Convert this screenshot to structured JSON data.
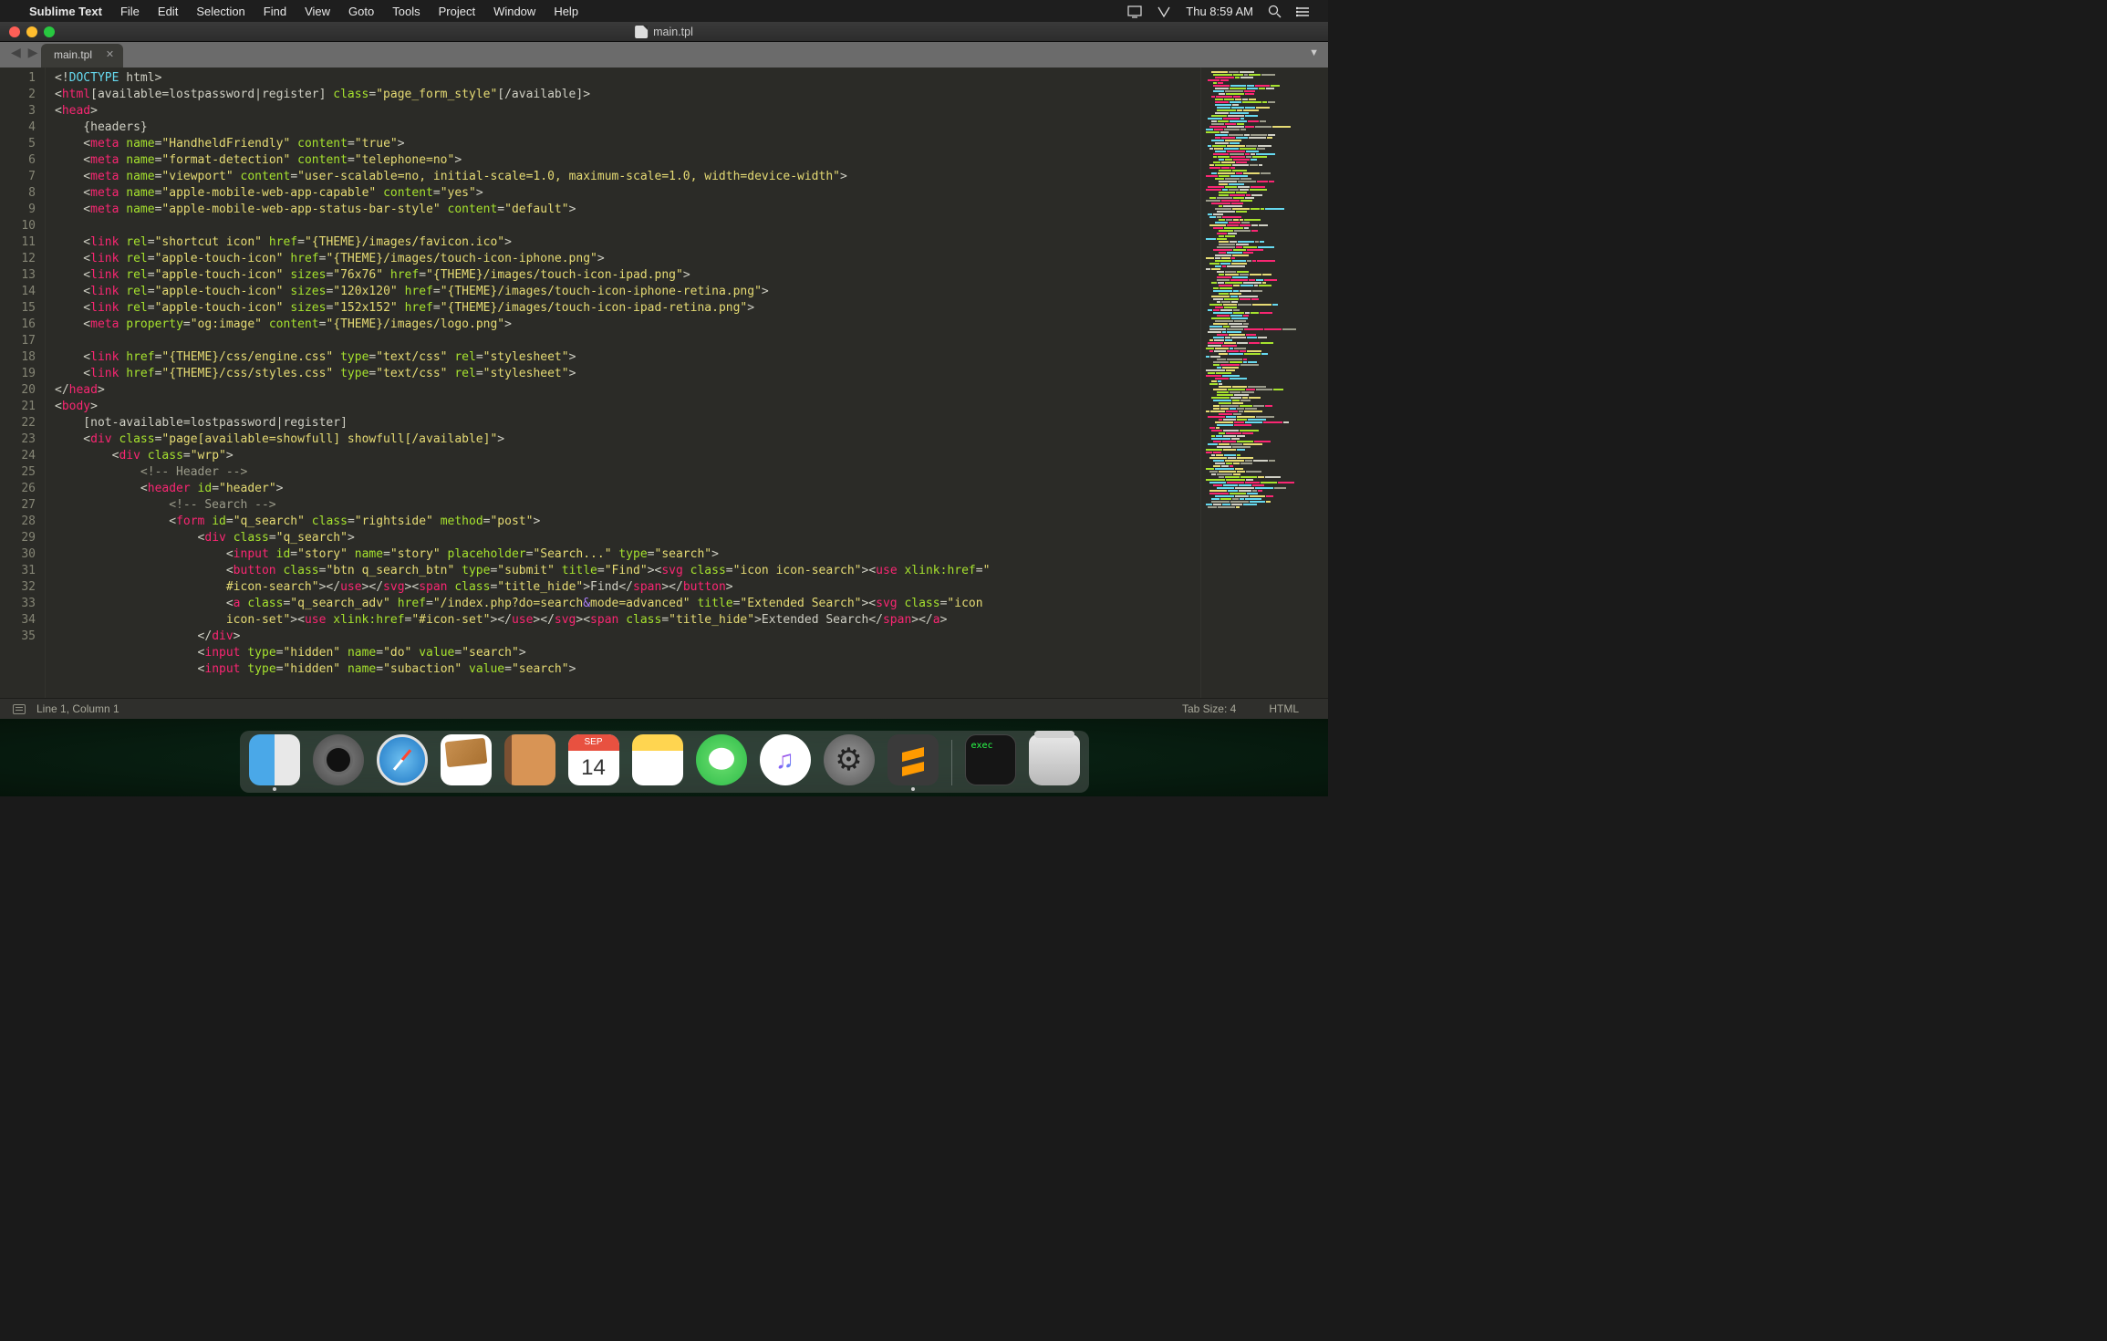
{
  "menubar": {
    "app": "Sublime Text",
    "items": [
      "File",
      "Edit",
      "Selection",
      "Find",
      "View",
      "Goto",
      "Tools",
      "Project",
      "Window",
      "Help"
    ],
    "clock": "Thu 8:59 AM"
  },
  "titlebar": {
    "filename": "main.tpl"
  },
  "tab": {
    "name": "main.tpl"
  },
  "gutter_lines": [
    "1",
    "2",
    "3",
    "4",
    "5",
    "6",
    "7",
    "8",
    "9",
    "10",
    "11",
    "12",
    "13",
    "14",
    "15",
    "16",
    "17",
    "18",
    "19",
    "20",
    "21",
    "22",
    "23",
    "24",
    "25",
    "26",
    "27",
    "28",
    "29",
    "30",
    "31",
    "32",
    "33",
    "34",
    "35"
  ],
  "code": {
    "l1": {
      "a": "<!",
      "b": "DOCTYPE",
      "c": " html",
      "d": ">"
    },
    "l2": {
      "a": "<",
      "b": "html",
      "c": "[available=lostpassword|register] ",
      "d": "class",
      "e": "=",
      "f": "\"page_form_style\"",
      "g": "[/available]",
      "h": ">"
    },
    "l3": {
      "a": "<",
      "b": "head",
      "c": ">"
    },
    "l4": "    {headers}",
    "l5": {
      "a": "    <",
      "b": "meta",
      "sp": " ",
      "c": "name",
      "d": "=",
      "e": "\"HandheldFriendly\"",
      "sp2": " ",
      "f": "content",
      "g": "=",
      "h": "\"true\"",
      "i": ">"
    },
    "l6": {
      "a": "    <",
      "b": "meta",
      "sp": " ",
      "c": "name",
      "d": "=",
      "e": "\"format-detection\"",
      "sp2": " ",
      "f": "content",
      "g": "=",
      "h": "\"telephone=no\"",
      "i": ">"
    },
    "l7": {
      "a": "    <",
      "b": "meta",
      "sp": " ",
      "c": "name",
      "d": "=",
      "e": "\"viewport\"",
      "sp2": " ",
      "f": "content",
      "g": "=",
      "h": "\"user-scalable=no, initial-scale=1.0, maximum-scale=1.0, width=device-width\"",
      "i": ">"
    },
    "l8": {
      "a": "    <",
      "b": "meta",
      "sp": " ",
      "c": "name",
      "d": "=",
      "e": "\"apple-mobile-web-app-capable\"",
      "sp2": " ",
      "f": "content",
      "g": "=",
      "h": "\"yes\"",
      "i": ">"
    },
    "l9": {
      "a": "    <",
      "b": "meta",
      "sp": " ",
      "c": "name",
      "d": "=",
      "e": "\"apple-mobile-web-app-status-bar-style\"",
      "sp2": " ",
      "f": "content",
      "g": "=",
      "h": "\"default\"",
      "i": ">"
    },
    "l11": {
      "a": "    <",
      "b": "link",
      "sp": " ",
      "c": "rel",
      "d": "=",
      "e": "\"shortcut icon\"",
      "sp2": " ",
      "f": "href",
      "g": "=",
      "h": "\"{THEME}/images/favicon.ico\"",
      "i": ">"
    },
    "l12": {
      "a": "    <",
      "b": "link",
      "sp": " ",
      "c": "rel",
      "d": "=",
      "e": "\"apple-touch-icon\"",
      "sp2": " ",
      "f": "href",
      "g": "=",
      "h": "\"{THEME}/images/touch-icon-iphone.png\"",
      "i": ">"
    },
    "l13": {
      "a": "    <",
      "b": "link",
      "sp": " ",
      "c": "rel",
      "d": "=",
      "e": "\"apple-touch-icon\"",
      "sp2": " ",
      "f": "sizes",
      "g": "=",
      "h": "\"76x76\"",
      "sp3": " ",
      "i": "href",
      "j": "=",
      "k": "\"{THEME}/images/touch-icon-ipad.png\"",
      "l": ">"
    },
    "l14": {
      "a": "    <",
      "b": "link",
      "sp": " ",
      "c": "rel",
      "d": "=",
      "e": "\"apple-touch-icon\"",
      "sp2": " ",
      "f": "sizes",
      "g": "=",
      "h": "\"120x120\"",
      "sp3": " ",
      "i": "href",
      "j": "=",
      "k": "\"{THEME}/images/touch-icon-iphone-retina.png\"",
      "l": ">"
    },
    "l15": {
      "a": "    <",
      "b": "link",
      "sp": " ",
      "c": "rel",
      "d": "=",
      "e": "\"apple-touch-icon\"",
      "sp2": " ",
      "f": "sizes",
      "g": "=",
      "h": "\"152x152\"",
      "sp3": " ",
      "i": "href",
      "j": "=",
      "k": "\"{THEME}/images/touch-icon-ipad-retina.png\"",
      "l": ">"
    },
    "l16": {
      "a": "    <",
      "b": "meta",
      "sp": " ",
      "c": "property",
      "d": "=",
      "e": "\"og:image\"",
      "sp2": " ",
      "f": "content",
      "g": "=",
      "h": "\"{THEME}/images/logo.png\"",
      "i": ">"
    },
    "l18": {
      "a": "    <",
      "b": "link",
      "sp": " ",
      "c": "href",
      "d": "=",
      "e": "\"{THEME}/css/engine.css\"",
      "sp2": " ",
      "f": "type",
      "g": "=",
      "h": "\"text/css\"",
      "sp3": " ",
      "i": "rel",
      "j": "=",
      "k": "\"stylesheet\"",
      "l": ">"
    },
    "l19": {
      "a": "    <",
      "b": "link",
      "sp": " ",
      "c": "href",
      "d": "=",
      "e": "\"{THEME}/css/styles.css\"",
      "sp2": " ",
      "f": "type",
      "g": "=",
      "h": "\"text/css\"",
      "sp3": " ",
      "i": "rel",
      "j": "=",
      "k": "\"stylesheet\"",
      "l": ">"
    },
    "l20": {
      "a": "</",
      "b": "head",
      "c": ">"
    },
    "l21": {
      "a": "<",
      "b": "body",
      "c": ">"
    },
    "l22": "    [not-available=lostpassword|register]",
    "l23": {
      "a": "    <",
      "b": "div",
      "sp": " ",
      "c": "class",
      "d": "=",
      "e": "\"page[available=showfull] showfull[/available]\"",
      "f": ">"
    },
    "l24": {
      "a": "        <",
      "b": "div",
      "sp": " ",
      "c": "class",
      "d": "=",
      "e": "\"wrp\"",
      "f": ">"
    },
    "l25": "            <!-- Header -->",
    "l26": {
      "a": "            <",
      "b": "header",
      "sp": " ",
      "c": "id",
      "d": "=",
      "e": "\"header\"",
      "f": ">"
    },
    "l27": "                <!-- Search -->",
    "l28": {
      "a": "                <",
      "b": "form",
      "sp": " ",
      "c": "id",
      "d": "=",
      "e": "\"q_search\"",
      "sp2": " ",
      "f": "class",
      "g": "=",
      "h": "\"rightside\"",
      "sp3": " ",
      "i": "method",
      "j": "=",
      "k": "\"post\"",
      "l": ">"
    },
    "l29": {
      "a": "                    <",
      "b": "div",
      "sp": " ",
      "c": "class",
      "d": "=",
      "e": "\"q_search\"",
      "f": ">"
    },
    "l30": {
      "a": "                        <",
      "b": "input",
      "sp": " ",
      "c": "id",
      "d": "=",
      "e": "\"story\"",
      "sp2": " ",
      "f": "name",
      "g": "=",
      "h": "\"story\"",
      "sp3": " ",
      "i": "placeholder",
      "j": "=",
      "k": "\"Search...\"",
      "sp4": " ",
      "l": "type",
      "m": "=",
      "n": "\"search\"",
      "o": ">"
    },
    "l31": {
      "p1": "                        <",
      "t1": "button",
      "sp1": " ",
      "a1": "class",
      "e1": "=",
      "v1": "\"btn q_search_btn\"",
      "sp2": " ",
      "a2": "type",
      "e2": "=",
      "v2": "\"submit\"",
      "sp3": " ",
      "a3": "title",
      "e3": "=",
      "v3": "\"Find\"",
      "p2": "><",
      "t2": "svg",
      "sp4": " ",
      "a4": "class",
      "e4": "=",
      "v4": "\"icon icon-search\"",
      "p3": "><",
      "t3": "use",
      "sp5": " ",
      "a5": "xlink:href",
      "e5": "=",
      "v5": "\"#icon-search\"",
      "p4": "></",
      "t4": "use",
      "p5": "></",
      "t5": "svg",
      "p6": "><",
      "t6": "span",
      "sp6": " ",
      "a6": "class",
      "e6": "=",
      "v6": "\"title_hide\"",
      "p7": ">",
      "tx": "Find",
      "p8": "</",
      "t7": "span",
      "p9": "></",
      "t8": "button",
      "p10": ">"
    },
    "l32": {
      "p1": "                        <",
      "t1": "a",
      "sp1": " ",
      "a1": "class",
      "e1": "=",
      "v1": "\"q_search_adv\"",
      "sp2": " ",
      "a2": "href",
      "e2": "=",
      "v2a": "\"/index.php?do=search",
      "amp": "&amp;",
      "v2b": "mode=advanced\"",
      "sp3": " ",
      "a3": "title",
      "e3": "=",
      "v3": "\"Extended Search\"",
      "p2": "><",
      "t2": "svg",
      "sp4": " ",
      "a4": "class",
      "e4": "=",
      "v4": "\"icon icon-set\"",
      "p3": "><",
      "t3": "use",
      "sp5": " ",
      "a5": "xlink:href",
      "e5": "=",
      "v5": "\"#icon-set\"",
      "p4": "></",
      "t4": "use",
      "p5": "></",
      "t5": "svg",
      "p6": "><",
      "t6": "span",
      "sp6": " ",
      "a6": "class",
      "e6": "=",
      "v6": "\"title_hide\"",
      "p7": ">",
      "tx": "Extended Search",
      "p8": "</",
      "t7": "span",
      "p9": "></",
      "t8": "a",
      "p10": ">"
    },
    "l33": {
      "a": "                    </",
      "b": "div",
      "c": ">"
    },
    "l34": {
      "a": "                    <",
      "b": "input",
      "sp": " ",
      "c": "type",
      "d": "=",
      "e": "\"hidden\"",
      "sp2": " ",
      "f": "name",
      "g": "=",
      "h": "\"do\"",
      "sp3": " ",
      "i": "value",
      "j": "=",
      "k": "\"search\"",
      "l": ">"
    },
    "l35": {
      "a": "                    <",
      "b": "input",
      "sp": " ",
      "c": "type",
      "d": "=",
      "e": "\"hidden\"",
      "sp2": " ",
      "f": "name",
      "g": "=",
      "h": "\"subaction\"",
      "sp3": " ",
      "i": "value",
      "j": "=",
      "k": "\"search\"",
      "l": ">"
    }
  },
  "statusbar": {
    "pos": "Line 1, Column 1",
    "tabsize": "Tab Size: 4",
    "syntax": "HTML"
  },
  "calendar": {
    "month": "SEP",
    "day": "14"
  },
  "terminal": {
    "text": "exec"
  }
}
